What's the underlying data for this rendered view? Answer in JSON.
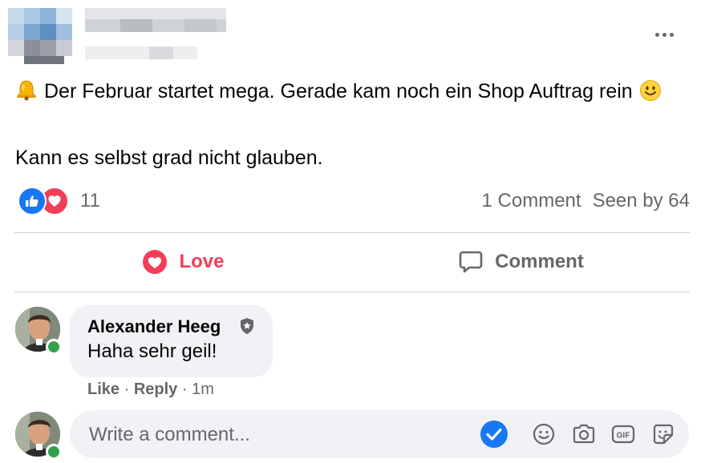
{
  "post": {
    "line1": "Der Februar startet mega. Gerade kam noch ein Shop Auftrag rein",
    "line2": "Kann es selbst grad nicht glauben."
  },
  "reactions": {
    "count": "11",
    "types": [
      "like",
      "love"
    ]
  },
  "stats": {
    "comments": "1 Comment",
    "seen": "Seen by 64"
  },
  "actions": {
    "love_label": "Love",
    "comment_label": "Comment"
  },
  "comment": {
    "author": "Alexander Heeg",
    "text": "Haha sehr geil!",
    "like_label": "Like",
    "reply_label": "Reply",
    "time": "1m",
    "separator": "·"
  },
  "composer": {
    "placeholder": "Write a comment..."
  },
  "colors": {
    "love": "#f33e58",
    "like": "#1877f2",
    "online": "#31a24c",
    "muted": "#65676b",
    "bubble": "#f0f2f5"
  },
  "icons": [
    "bell-emoji",
    "smile-emoji",
    "like-reaction-icon",
    "love-reaction-icon",
    "heart-icon",
    "speech-bubble-icon",
    "verified-badge-icon",
    "more-icon",
    "send-check-icon",
    "emoji-icon",
    "camera-icon",
    "gif-icon",
    "sticker-icon"
  ]
}
